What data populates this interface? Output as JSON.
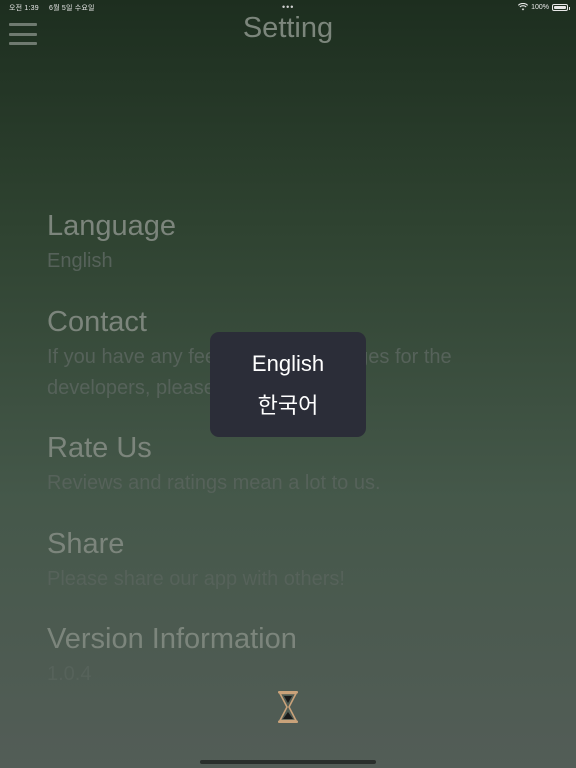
{
  "status_bar": {
    "time": "오전 1:39",
    "date": "6월 5일 수요일",
    "dots": "•••",
    "battery": "100%"
  },
  "header": {
    "title": "Setting",
    "menu_icon": "hamburger-menu-icon"
  },
  "settings": [
    {
      "id": "language",
      "title": "Language",
      "description": "English"
    },
    {
      "id": "contact",
      "title": "Contact",
      "description": "If you have any feedback or messages for the developers, please"
    },
    {
      "id": "rate-us",
      "title": "Rate Us",
      "description": "Reviews and ratings mean a lot to us."
    },
    {
      "id": "share",
      "title": "Share",
      "description": "Please share our app with others!"
    },
    {
      "id": "version",
      "title": "Version Information",
      "description": "1.0.4"
    }
  ],
  "language_popup": {
    "options": [
      "English",
      "한국어"
    ]
  },
  "loading_icon": "hourglass-icon",
  "colors": {
    "popup_background": "#2b2d38",
    "background_top": "#1d2e1f",
    "background_bottom": "#535d57",
    "hourglass": "#c9a27a"
  }
}
